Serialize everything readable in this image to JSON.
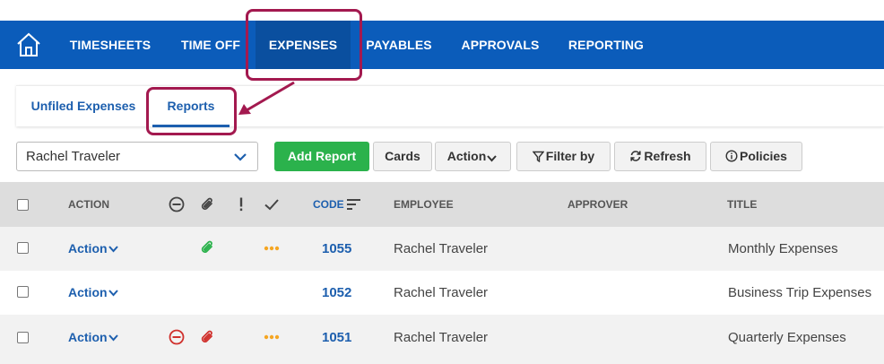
{
  "nav": {
    "items": [
      {
        "label": "TIMESHEETS"
      },
      {
        "label": "TIME OFF"
      },
      {
        "label": "EXPENSES"
      },
      {
        "label": "PAYABLES"
      },
      {
        "label": "APPROVALS"
      },
      {
        "label": "REPORTING"
      }
    ],
    "active": "EXPENSES"
  },
  "tabs": [
    {
      "label": "Unfiled Expenses"
    },
    {
      "label": "Reports"
    }
  ],
  "toolbar": {
    "employee_value": "Rachel Traveler",
    "add_report": "Add Report",
    "cards": "Cards",
    "action": "Action",
    "filter_by": "Filter by",
    "refresh": "Refresh",
    "policies": "Policies"
  },
  "table": {
    "columns": {
      "action": "ACTION",
      "code": "CODE",
      "employee": "EMPLOYEE",
      "approver": "APPROVER",
      "title": "TITLE"
    },
    "rows": [
      {
        "action": "Action",
        "code": "1055",
        "employee": "Rachel Traveler",
        "approver": "",
        "title": "Monthly Expenses",
        "rejected": false,
        "attachment": true,
        "attachment_color": "#2bb24c",
        "status": "pending"
      },
      {
        "action": "Action",
        "code": "1052",
        "employee": "Rachel Traveler",
        "approver": "",
        "title": "Business Trip Expenses",
        "rejected": false,
        "attachment": false,
        "status": "none"
      },
      {
        "action": "Action",
        "code": "1051",
        "employee": "Rachel Traveler",
        "approver": "",
        "title": "Quarterly Expenses",
        "rejected": true,
        "attachment": true,
        "attachment_color": "#d0312d",
        "status": "pending"
      }
    ]
  },
  "colors": {
    "nav_bg": "#0b5cba",
    "link_blue": "#1d5fae",
    "add_green": "#2bb24c",
    "callout": "#a3194f",
    "pending_dots": "#f5a623",
    "rejected_red": "#d0312d"
  }
}
